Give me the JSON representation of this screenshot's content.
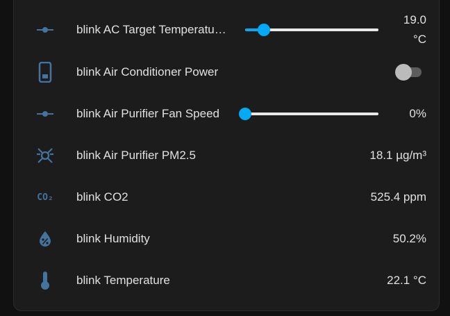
{
  "colors": {
    "icon": "#44739e",
    "accent": "#03a9f4",
    "text": "#e1e1e1",
    "card": "#1c1c1c"
  },
  "entities": {
    "ac_target_temp": {
      "name": "blink AC Target Temperatu…",
      "value": "19.0",
      "unit": "°C",
      "icon": "slider-icon",
      "slider_level": 0.14
    },
    "ac_power": {
      "name": "blink Air Conditioner Power",
      "icon": "phone-icon",
      "state": "off"
    },
    "purifier_fan_speed": {
      "name": "blink Air Purifier Fan Speed",
      "value": "0%",
      "icon": "slider-icon",
      "slider_level": 0.0
    },
    "purifier_pm25": {
      "name": "blink Air Purifier PM2.5",
      "value": "18.1 µg/m³",
      "icon": "molecule-icon"
    },
    "co2": {
      "name": "blink CO2",
      "value": "525.4 ppm",
      "icon": "co2-icon",
      "icon_text": "CO₂"
    },
    "humidity": {
      "name": "blink Humidity",
      "value": "50.2%",
      "icon": "water-percent-icon"
    },
    "temperature": {
      "name": "blink Temperature",
      "value": "22.1 °C",
      "icon": "thermometer-icon"
    }
  }
}
